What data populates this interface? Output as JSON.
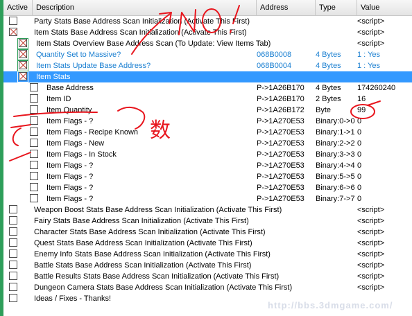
{
  "columns": {
    "active": "Active",
    "description": "Description",
    "address": "Address",
    "type": "Type",
    "value": "Value"
  },
  "rows": [
    {
      "desc": "Party Stats Base Address Scan Initialization (Activate This First)",
      "addr": "",
      "type": "",
      "val": "<script>"
    },
    {
      "desc": "Item Stats Base Address Scan Initialization (Activate This First)",
      "addr": "",
      "type": "",
      "val": "<script>"
    },
    {
      "desc": "Item Stats Overview Base Address Scan (To Update: View Items Tab)",
      "addr": "",
      "type": "",
      "val": "<script>"
    },
    {
      "desc": "Quantity Set to Massive?",
      "addr": "068B0008",
      "type": "4 Bytes",
      "val": "1 : Yes"
    },
    {
      "desc": "Item Stats Update Base Address?",
      "addr": "068B0004",
      "type": "4 Bytes",
      "val": "1 : Yes"
    },
    {
      "desc": "Item Stats",
      "addr": "",
      "type": "",
      "val": ""
    },
    {
      "desc": "Base Address",
      "addr": "P->1A26B170",
      "type": "4 Bytes",
      "val": "174260240"
    },
    {
      "desc": "Item ID",
      "addr": "P->1A26B170",
      "type": "2 Bytes",
      "val": "16"
    },
    {
      "desc": "Item Quantity",
      "addr": "P->1A26B172",
      "type": "Byte",
      "val": "99"
    },
    {
      "desc": "Item Flags - ?",
      "addr": "P->1A270E53",
      "type": "Binary:0->0",
      "val": "0"
    },
    {
      "desc": "Item Flags - Recipe Known",
      "addr": "P->1A270E53",
      "type": "Binary:1->1",
      "val": "0"
    },
    {
      "desc": "Item Flags - New",
      "addr": "P->1A270E53",
      "type": "Binary:2->2",
      "val": "0"
    },
    {
      "desc": "Item Flags - In Stock",
      "addr": "P->1A270E53",
      "type": "Binary:3->3",
      "val": "0"
    },
    {
      "desc": "Item Flags - ?",
      "addr": "P->1A270E53",
      "type": "Binary:4->4",
      "val": "0"
    },
    {
      "desc": "Item Flags - ?",
      "addr": "P->1A270E53",
      "type": "Binary:5->5",
      "val": "0"
    },
    {
      "desc": "Item Flags - ?",
      "addr": "P->1A270E53",
      "type": "Binary:6->6",
      "val": "0"
    },
    {
      "desc": "Item Flags - ?",
      "addr": "P->1A270E53",
      "type": "Binary:7->7",
      "val": "0"
    },
    {
      "desc": "Weapon Boost Stats Base Address Scan Initialization (Activate This First)",
      "addr": "",
      "type": "",
      "val": "<script>"
    },
    {
      "desc": "Fairy Stats Base Address Scan Initialization (Activate This First)",
      "addr": "",
      "type": "",
      "val": "<script>"
    },
    {
      "desc": "Character Stats Base Address Scan Initialization (Activate This First)",
      "addr": "",
      "type": "",
      "val": "<script>"
    },
    {
      "desc": "Quest Stats Base Address Scan Initialization (Activate This First)",
      "addr": "",
      "type": "",
      "val": "<script>"
    },
    {
      "desc": "Enemy Info Stats Base Address Scan Initialization (Activate This First)",
      "addr": "",
      "type": "",
      "val": "<script>"
    },
    {
      "desc": "Battle Stats Base Address Scan Initialization (Activate This First)",
      "addr": "",
      "type": "",
      "val": "<script>"
    },
    {
      "desc": "Battle Results Stats Base Address Scan Initialization (Activate This First)",
      "addr": "",
      "type": "",
      "val": "<script>"
    },
    {
      "desc": "Dungeon Camera Stats Base Address Scan Initialization (Activate This First)",
      "addr": "",
      "type": "",
      "val": "<script>"
    },
    {
      "desc": "Ideas / Fixes - Thanks!",
      "addr": "",
      "type": "",
      "val": ""
    }
  ],
  "annotations": {
    "no": "NO!",
    "shu": "数"
  },
  "watermark": "http://bbs.3dmgame.com/",
  "colors": {
    "selection": "#3399ff",
    "child_text": "#1a7fd1",
    "left_bar": "#2e9e5a",
    "annotation": "#e8151d"
  }
}
